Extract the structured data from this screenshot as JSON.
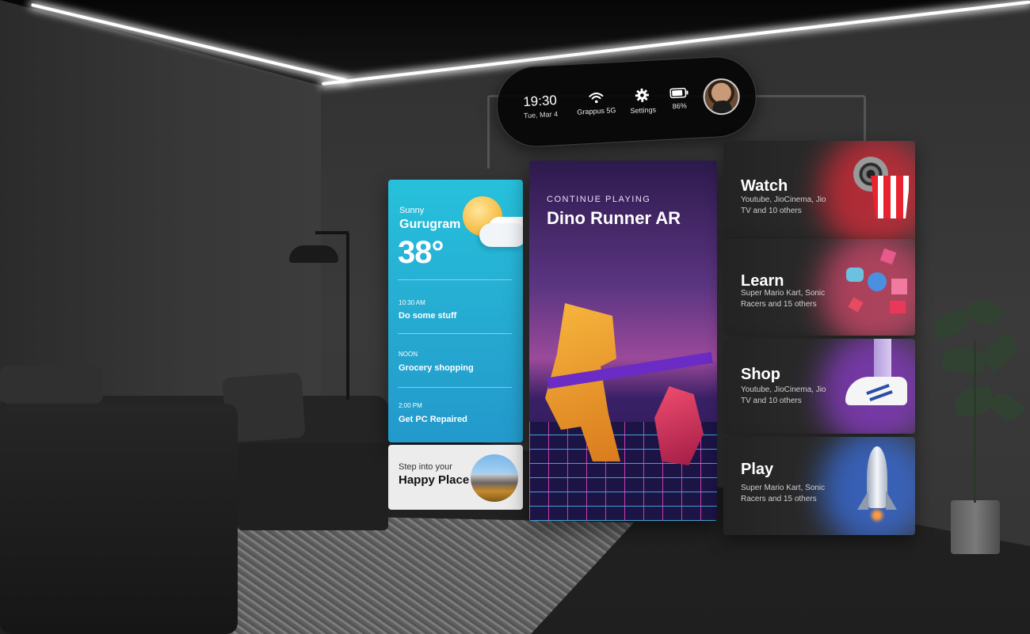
{
  "status_bar": {
    "time": "19:30",
    "date": "Tue, Mar 4",
    "wifi_label": "Grappus 5G",
    "wifi_icon": "wifi-icon",
    "settings_label": "Settings",
    "settings_icon": "gear-icon",
    "battery_label": "86%",
    "battery_icon": "battery-icon",
    "battery_level": 0.86
  },
  "weather": {
    "condition": "Sunny",
    "city": "Gurugram",
    "temperature": "38°",
    "icon": "sun-cloud-icon"
  },
  "agenda": [
    {
      "time": "10:30 AM",
      "title": "Do some stuff"
    },
    {
      "time": "NOON",
      "title": "Grocery shopping"
    },
    {
      "time": "2:00 PM",
      "title": "Get PC Repaired"
    }
  ],
  "happy_place": {
    "line1": "Step into your",
    "line2": "Happy Place"
  },
  "continue_playing": {
    "label": "CONTINUE PLAYING",
    "title": "Dino Runner AR"
  },
  "categories": [
    {
      "name": "Watch",
      "description": "Youtube, JioCinema, Jio TV and 10 others",
      "icon": "popcorn-film-icon",
      "accent": "#d92b39"
    },
    {
      "name": "Learn",
      "description": "Super Mario Kart, Sonic Racers and 15 others",
      "icon": "shapes-icon",
      "accent": "#d4486b"
    },
    {
      "name": "Shop",
      "description": "Youtube, JioCinema, Jio TV and 10 others",
      "icon": "sneaker-icon",
      "accent": "#8b3bc9"
    },
    {
      "name": "Play",
      "description": "Super Mario Kart, Sonic Racers and 15 others",
      "icon": "rocket-icon",
      "accent": "#3a6fe0"
    }
  ]
}
